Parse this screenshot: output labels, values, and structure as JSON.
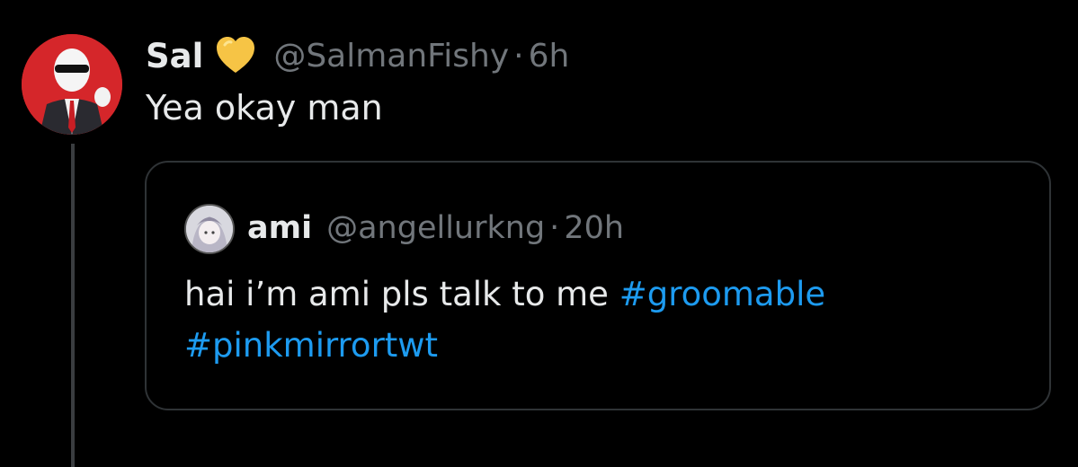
{
  "tweet": {
    "author_name": "Sal",
    "author_handle": "@SalmanFishy",
    "separator": "·",
    "time": "6h",
    "text": "Yea okay man",
    "badge_icon": "yellow-heart-icon"
  },
  "quote": {
    "author_name": "ami",
    "author_handle": "@angellurkng",
    "separator": "·",
    "time": "20h",
    "text_before": "hai i’m ami pls talk to me ",
    "hashtags": [
      "#groomable",
      "#pinkmirrortwt"
    ]
  },
  "colors": {
    "background": "#000000",
    "text": "#e7e9ea",
    "muted": "#71767b",
    "link": "#1d9bf0",
    "border": "#2f3336",
    "heart": "#f6c445"
  }
}
